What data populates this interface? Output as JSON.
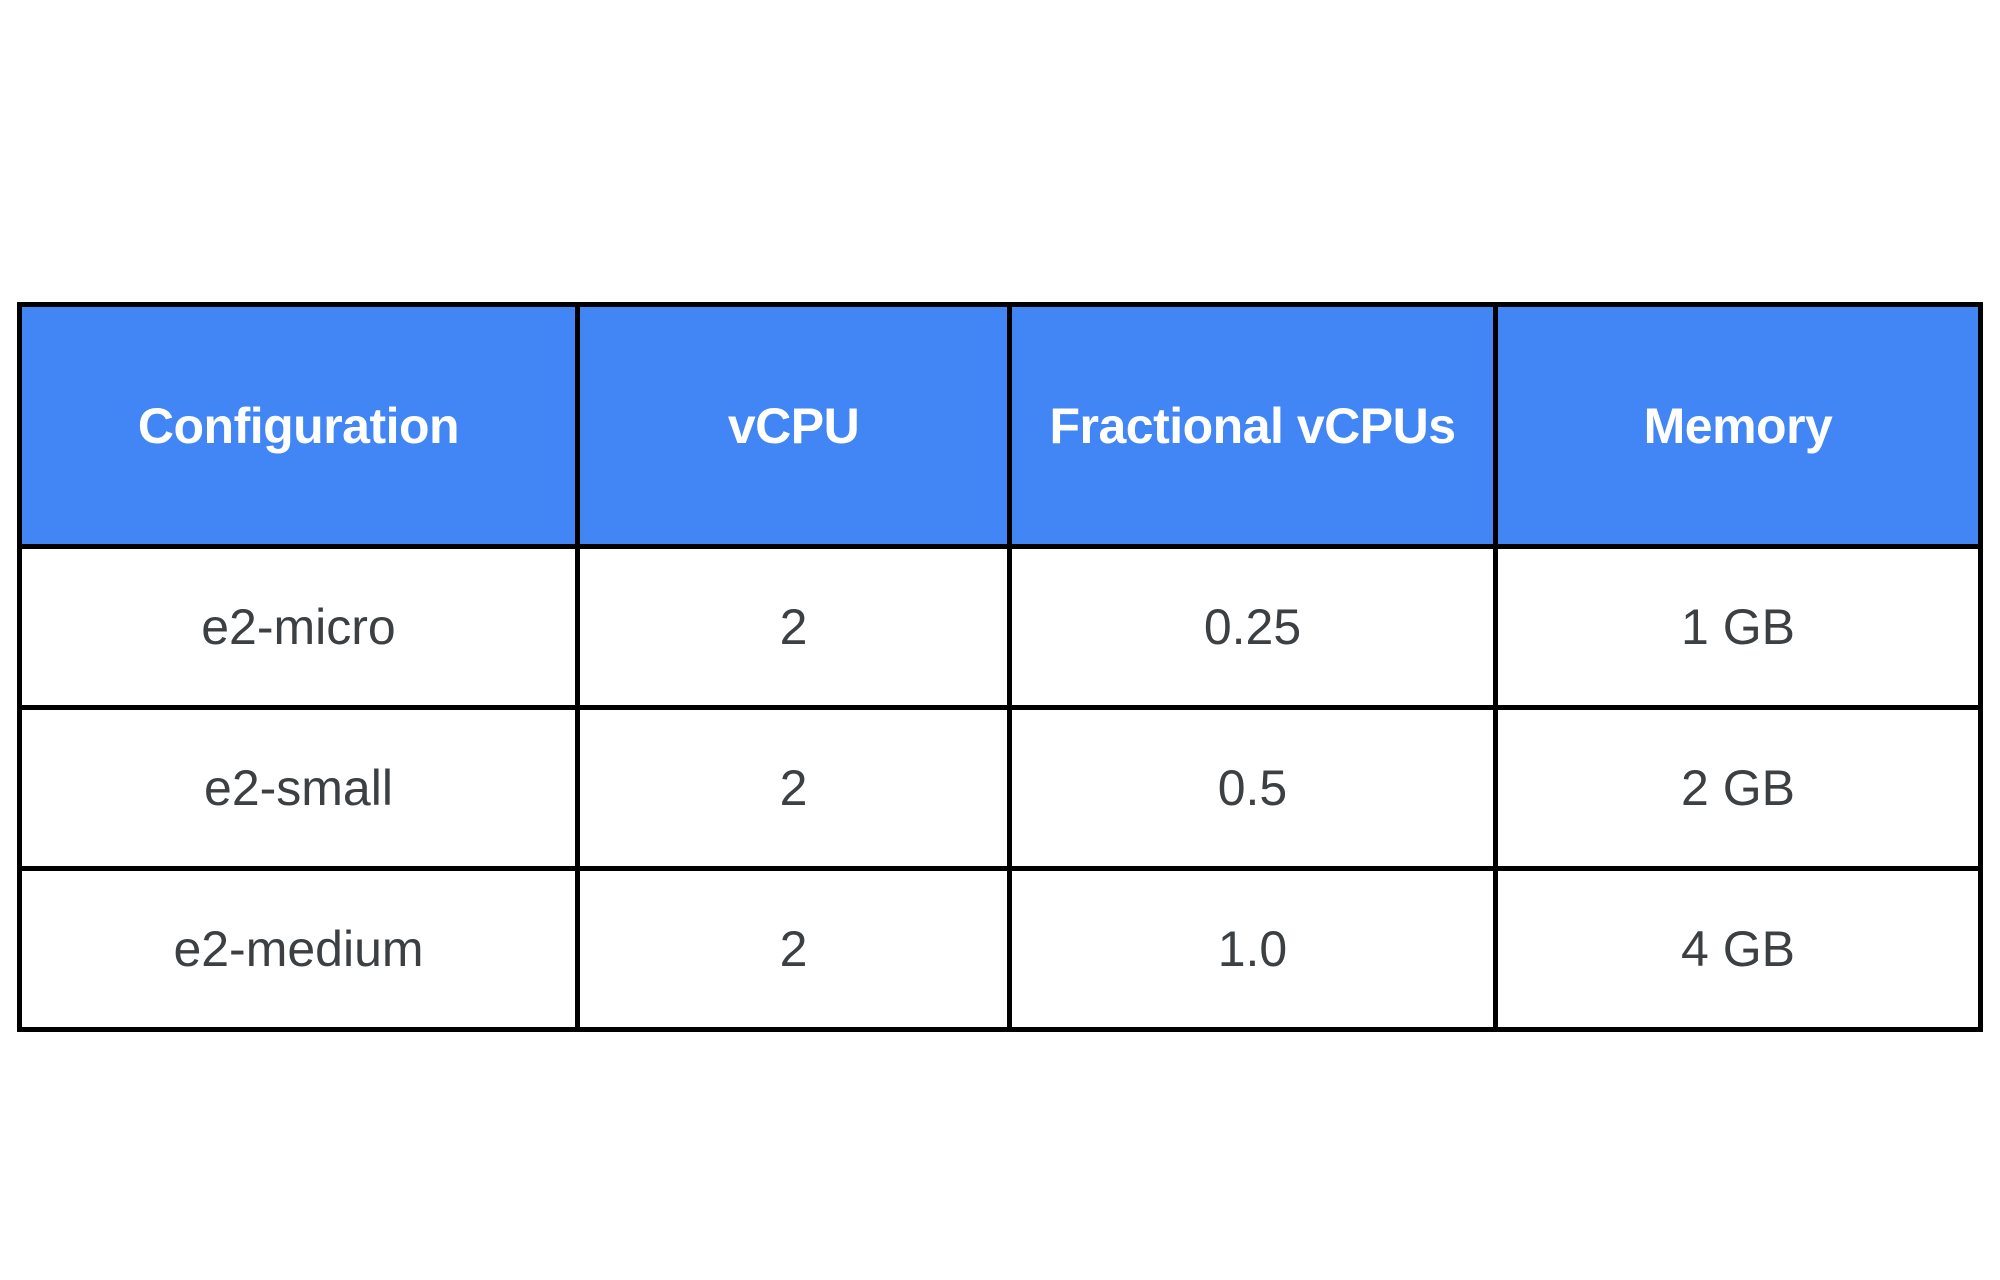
{
  "document": {
    "kind": "comparison-table",
    "background_color": "#FFFFFF"
  },
  "table": {
    "header_background_color": "#4285F4",
    "header_text_color": "#FFFFFF",
    "body_text_color": "#3C4043",
    "border_color": "#000000",
    "columns": [
      {
        "key": "configuration",
        "label": "Configuration"
      },
      {
        "key": "vcpu",
        "label": "vCPU"
      },
      {
        "key": "fractional_vcpus",
        "label": "Fractional vCPUs"
      },
      {
        "key": "memory",
        "label": "Memory"
      }
    ],
    "rows": [
      {
        "configuration": "e2-micro",
        "vcpu": "2",
        "fractional_vcpus": "0.25",
        "memory": "1 GB"
      },
      {
        "configuration": "e2-small",
        "vcpu": "2",
        "fractional_vcpus": "0.5",
        "memory": "2 GB"
      },
      {
        "configuration": "e2-medium",
        "vcpu": "2",
        "fractional_vcpus": "1.0",
        "memory": "4 GB"
      }
    ]
  }
}
